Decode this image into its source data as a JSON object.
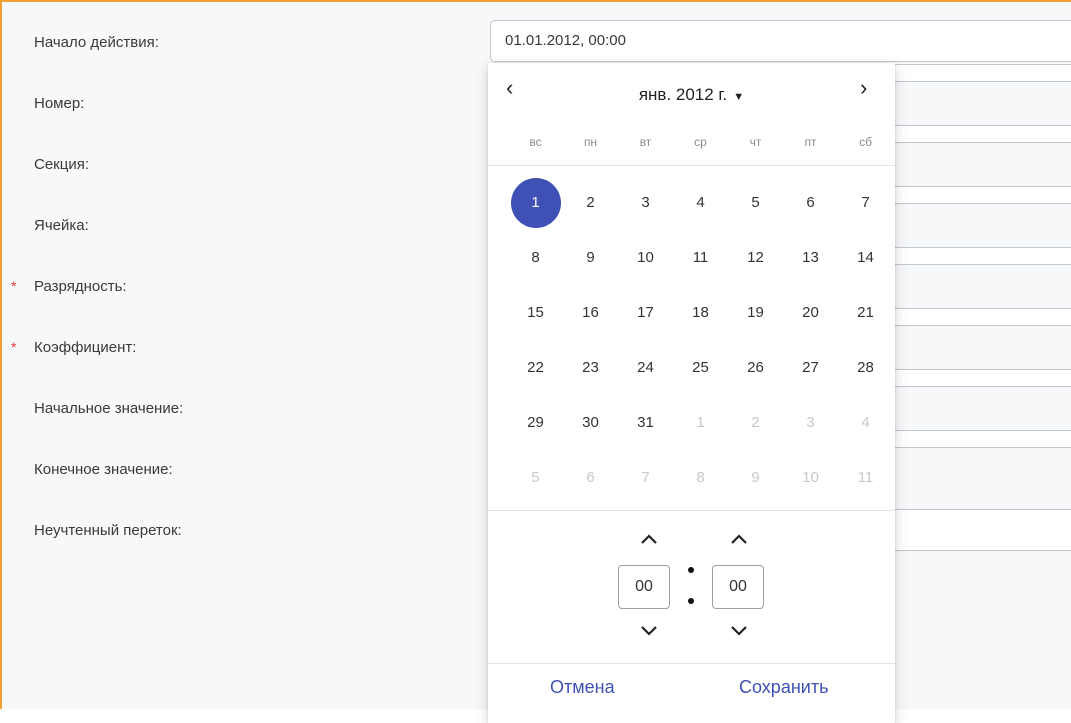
{
  "form": {
    "fields": [
      {
        "label": "Начало действия:",
        "required": false,
        "value": "01.01.2012, 00:00"
      },
      {
        "label": "Номер:",
        "required": false,
        "value": ""
      },
      {
        "label": "Секция:",
        "required": false,
        "value": ""
      },
      {
        "label": "Ячейка:",
        "required": false,
        "value": ""
      },
      {
        "label": "Разрядность:",
        "required": true,
        "value": ""
      },
      {
        "label": "Коэффициент:",
        "required": true,
        "value": ""
      },
      {
        "label": "Начальное значение:",
        "required": false,
        "value": ""
      },
      {
        "label": "Конечное значение:",
        "required": false,
        "value": ""
      },
      {
        "label": "Неучтенный переток:",
        "required": false,
        "value": ""
      }
    ],
    "required_mark": "*"
  },
  "datepicker": {
    "prev_icon": "chevron-left-icon",
    "next_icon": "chevron-right-icon",
    "prev_glyph": "‹",
    "next_glyph": "›",
    "month_label": "янв. 2012 г.",
    "caret_glyph": "▼",
    "weekdays": [
      "вс",
      "пн",
      "вт",
      "ср",
      "чт",
      "пт",
      "сб"
    ],
    "weeks": [
      [
        "1",
        "2",
        "3",
        "4",
        "5",
        "6",
        "7"
      ],
      [
        "8",
        "9",
        "10",
        "11",
        "12",
        "13",
        "14"
      ],
      [
        "15",
        "16",
        "17",
        "18",
        "19",
        "20",
        "21"
      ],
      [
        "22",
        "23",
        "24",
        "25",
        "26",
        "27",
        "28"
      ],
      [
        "29",
        "30",
        "31",
        "1",
        "2",
        "3",
        "4"
      ],
      [
        "5",
        "6",
        "7",
        "8",
        "9",
        "10",
        "11"
      ]
    ],
    "selected_day": "1",
    "time": {
      "hours": "00",
      "minutes": "00"
    },
    "cancel_label": "Отмена",
    "save_label": "Сохранить",
    "accent_color": "#3f51b5"
  }
}
